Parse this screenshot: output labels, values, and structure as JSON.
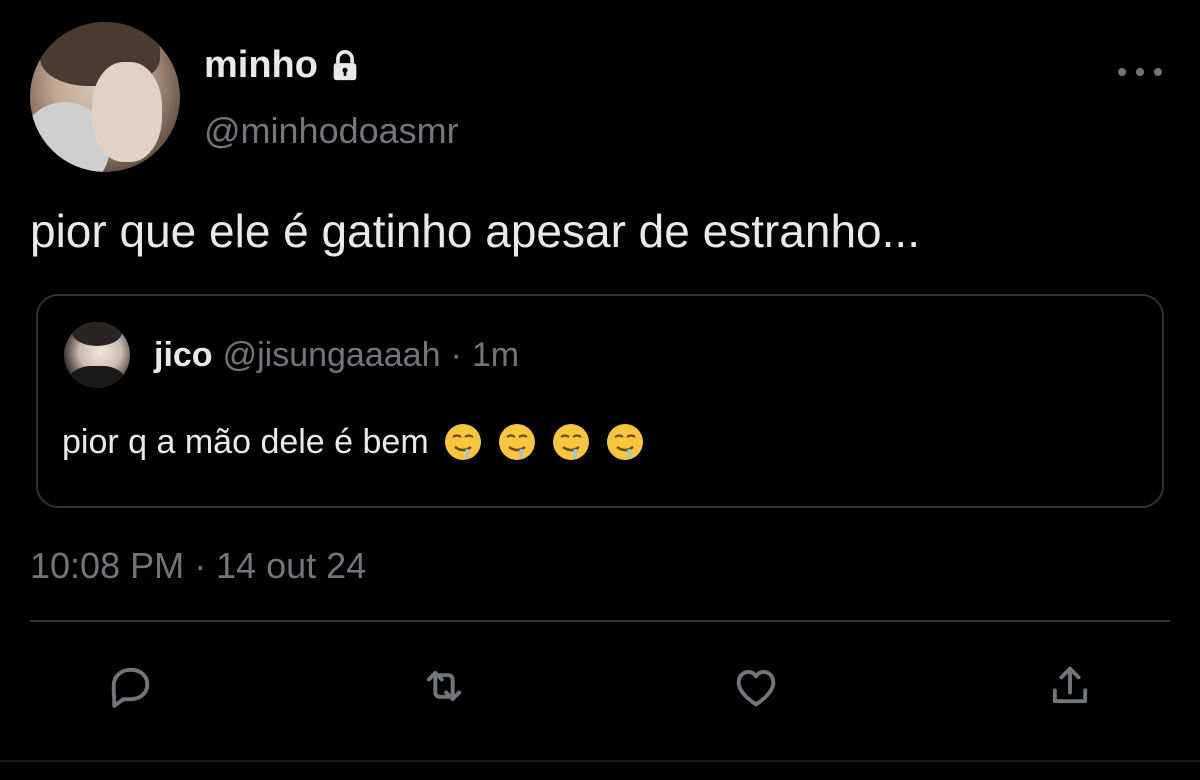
{
  "author": {
    "display_name": "minho",
    "handle": "@minhodoasmr",
    "protected_icon": "lock-icon"
  },
  "tweet": {
    "text": "pior que ele é gatinho apesar de estranho..."
  },
  "quoted_tweet": {
    "display_name": "jico",
    "handle": "@jisungaaaah",
    "separator": "·",
    "time": "1m",
    "text": "pior q a mão dele é bem",
    "emojis": [
      "drooling-face",
      "drooling-face",
      "drooling-face",
      "drooling-face"
    ]
  },
  "timestamp": "10:08 PM · 14 out 24",
  "actions": [
    "reply-icon",
    "retweet-icon",
    "like-icon",
    "share-icon"
  ],
  "colors": {
    "background": "#000000",
    "primary_text": "#e7e9ea",
    "secondary_text": "#71767b",
    "border": "#2f3336"
  }
}
